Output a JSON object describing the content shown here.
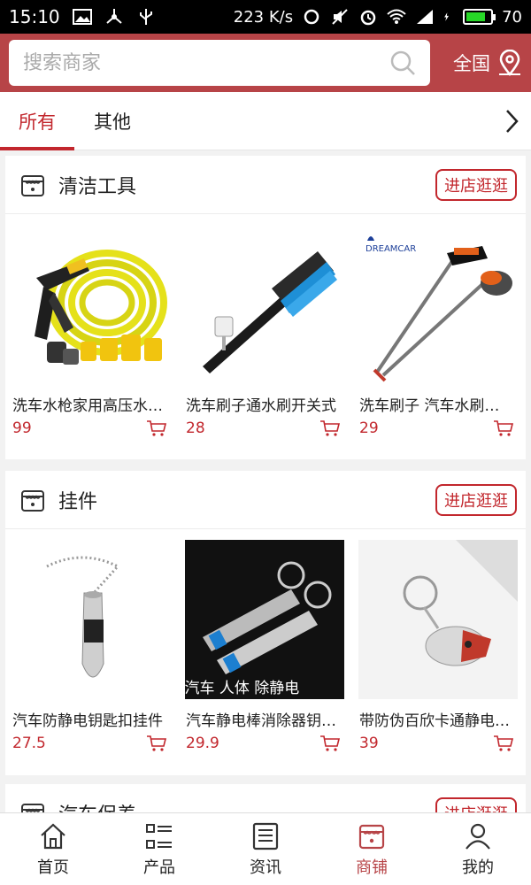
{
  "statusbar": {
    "time": "15:10",
    "speed": "223 K/s",
    "battery": "70"
  },
  "search": {
    "placeholder": "搜索商家",
    "region": "全国"
  },
  "tabs": [
    {
      "label": "所有"
    },
    {
      "label": "其他"
    }
  ],
  "shops": [
    {
      "name": "清洁工具",
      "enter": "进店逛逛",
      "products": [
        {
          "title": "洗车水枪家用高压水枪套装",
          "price": "99"
        },
        {
          "title": "洗车刷子通水刷开关式",
          "price": "28"
        },
        {
          "title": "洗车刷子 汽车水刷伸缩",
          "price": "29"
        }
      ]
    },
    {
      "name": "挂件",
      "enter": "进店逛逛",
      "products": [
        {
          "title": "汽车防静电钥匙扣挂件",
          "price": "27.5"
        },
        {
          "title": "汽车静电棒消除器钥匙扣",
          "price": "29.9"
        },
        {
          "title": "带防伪百欣卡通静电钥匙扣",
          "price": "39"
        }
      ]
    },
    {
      "name": "汽车保养",
      "enter": "进店逛逛",
      "products": []
    }
  ],
  "product_image_caption": "汽车 人体 除静电",
  "tabbar": [
    {
      "label": "首页",
      "icon": "home-icon"
    },
    {
      "label": "产品",
      "icon": "list-icon"
    },
    {
      "label": "资讯",
      "icon": "news-icon"
    },
    {
      "label": "商铺",
      "icon": "store-icon"
    },
    {
      "label": "我的",
      "icon": "user-icon"
    }
  ],
  "colors": {
    "brand": "#b74447",
    "accent": "#c2272d"
  }
}
